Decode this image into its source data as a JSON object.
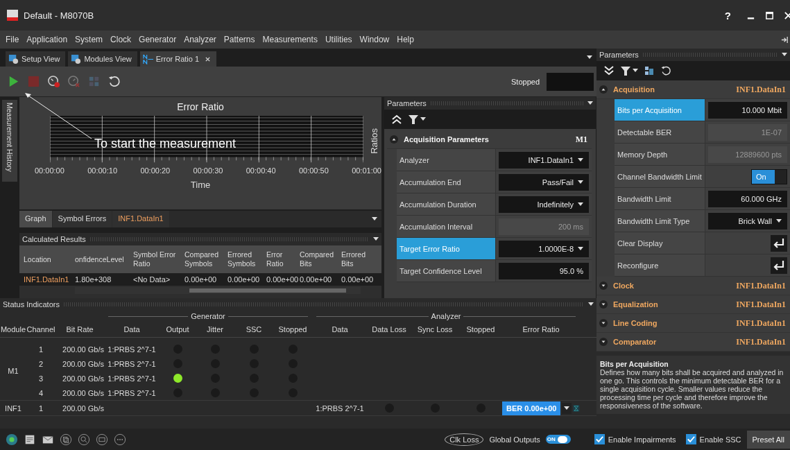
{
  "window": {
    "title": "Default - M8070B",
    "help": "?"
  },
  "menu": [
    "File",
    "Application",
    "System",
    "Clock",
    "Generator",
    "Analyzer",
    "Patterns",
    "Measurements",
    "Utilities",
    "Window",
    "Help"
  ],
  "tabs": [
    {
      "label": "Setup View",
      "selected": false,
      "closable": false
    },
    {
      "label": "Modules View",
      "selected": false,
      "closable": false
    },
    {
      "label": "Error Ratio 1",
      "selected": true,
      "closable": true
    }
  ],
  "toolbar": {
    "status": "Stopped"
  },
  "side_tab": "Measurement History",
  "chart": {
    "title": "Error Ratio",
    "ylabel": "Ratios",
    "xlabel": "Time",
    "xtick_labels": [
      "00:00:00",
      "00:00:10",
      "00:00:20",
      "00:00:30",
      "00:00:40",
      "00:00:50",
      "00:01:00"
    ]
  },
  "annotation": "To start the measurement",
  "subtabs": [
    {
      "label": "Graph",
      "selected": true,
      "kind": "tab"
    },
    {
      "label": "Symbol Errors",
      "selected": false,
      "kind": "tab"
    },
    {
      "label": "INF1.DataIn1",
      "selected": false,
      "kind": "location"
    }
  ],
  "results": {
    "title": "Calculated Results",
    "columns": [
      "Location",
      "onfidenceLevel",
      "Symbol Error Ratio",
      "Compared Symbols",
      "Errored Symbols",
      "Error Ratio",
      "Compared Bits",
      "Errored Bits"
    ],
    "rows": [
      [
        "INF1.DataIn1",
        "1.80e+308",
        "<No Data>",
        "0.00e+00",
        "0.00e+00",
        "0.00e+00",
        "0.00e+00",
        "0.00e+00"
      ]
    ]
  },
  "params": {
    "title": "Parameters",
    "section": "Acquisition Parameters",
    "module": "M1",
    "rows": [
      {
        "label": "Analyzer",
        "value": "INF1.DataIn1",
        "kind": "dropdown",
        "selected": false
      },
      {
        "label": "Accumulation End",
        "value": "Pass/Fail",
        "kind": "dropdown",
        "selected": false
      },
      {
        "label": "Accumulation Duration",
        "value": "Indefinitely",
        "kind": "dropdown",
        "selected": false
      },
      {
        "label": "Accumulation Interval",
        "value": "200 ms",
        "kind": "readonly",
        "selected": false
      },
      {
        "label": "Target Error Ratio",
        "value": "1.0000E-8",
        "kind": "dropdown",
        "selected": true
      },
      {
        "label": "Target Confidence Level",
        "value": "95.0 %",
        "kind": "input",
        "selected": false
      }
    ]
  },
  "side_params": {
    "title": "Parameters",
    "sections": [
      {
        "title": "Acquisition",
        "location": "INF1.DataIn1",
        "expanded": true,
        "rows": [
          {
            "label": "Bits per Acquisition",
            "value": "10.000 Mbit",
            "kind": "input",
            "selected": true
          },
          {
            "label": "Detectable BER",
            "value": "1E-07",
            "kind": "readonly",
            "selected": false
          },
          {
            "label": "Memory Depth",
            "value": "12889600 pts",
            "kind": "readonly",
            "selected": false
          },
          {
            "label": "Channel Bandwidth Limit",
            "value": "On",
            "kind": "toggle",
            "on": true,
            "selected": false
          },
          {
            "label": "Bandwidth Limit",
            "value": "60.000 GHz",
            "kind": "input",
            "selected": false
          },
          {
            "label": "Bandwidth Limit Type",
            "value": "Brick Wall",
            "kind": "dropdown",
            "selected": false
          },
          {
            "label": "Clear Display",
            "kind": "action",
            "selected": false
          },
          {
            "label": "Reconfigure",
            "kind": "action",
            "selected": false
          }
        ]
      },
      {
        "title": "Clock",
        "location": "INF1.DataIn1",
        "expanded": false
      },
      {
        "title": "Equalization",
        "location": "INF1.DataIn1",
        "expanded": false
      },
      {
        "title": "Line Coding",
        "location": "INF1.DataIn1",
        "expanded": false
      },
      {
        "title": "Comparator",
        "location": "INF1.DataIn1",
        "expanded": false
      }
    ],
    "help_title": "Bits per Acquisition",
    "help_text": "Defines how many bits shall be acquired and analyzed in one go. This controls the minimum detectable BER for a single acquisition cycle. Smaller values reduce the processing time per cycle and therefore improve the responsiveness of the software."
  },
  "status": {
    "title": "Status Indicators",
    "groups": [
      "Generator",
      "Analyzer"
    ],
    "columns": [
      "Module",
      "Channel",
      "Bit Rate",
      "Data",
      "Output",
      "Jitter",
      "SSC",
      "Stopped",
      "Data",
      "Data Loss",
      "Sync Loss",
      "Stopped",
      "Error Ratio"
    ],
    "modules": [
      {
        "name": "M1",
        "channels": [
          {
            "channel": "1",
            "bit_rate": "200.00 Gb/s",
            "gen_data": "1:PRBS 2^7-1",
            "output": false,
            "jitter": false,
            "ssc": false,
            "stopped": false
          },
          {
            "channel": "2",
            "bit_rate": "200.00 Gb/s",
            "gen_data": "1:PRBS 2^7-1",
            "output": false,
            "jitter": false,
            "ssc": false,
            "stopped": false
          },
          {
            "channel": "3",
            "bit_rate": "200.00 Gb/s",
            "gen_data": "1:PRBS 2^7-1",
            "output": true,
            "jitter": false,
            "ssc": false,
            "stopped": false
          },
          {
            "channel": "4",
            "bit_rate": "200.00 Gb/s",
            "gen_data": "1:PRBS 2^7-1",
            "output": false,
            "jitter": false,
            "ssc": false,
            "stopped": false
          }
        ]
      },
      {
        "name": "INF1",
        "channels": [
          {
            "channel": "1",
            "bit_rate": "200.00 Gb/s",
            "ana_data": "1:PRBS 2^7-1",
            "data_loss": false,
            "sync_loss": false,
            "ana_stopped": false,
            "error_ratio": "BER 0.00e+00"
          }
        ]
      }
    ]
  },
  "bottom": {
    "clk_loss": "Clk Loss",
    "global_outputs": "Global Outputs",
    "global_on": true,
    "global_toggle_text": "ON",
    "checkboxes": [
      {
        "label": "Enable Impairments",
        "checked": true
      },
      {
        "label": "Enable SSC",
        "checked": true
      }
    ],
    "preset": "Preset All"
  }
}
